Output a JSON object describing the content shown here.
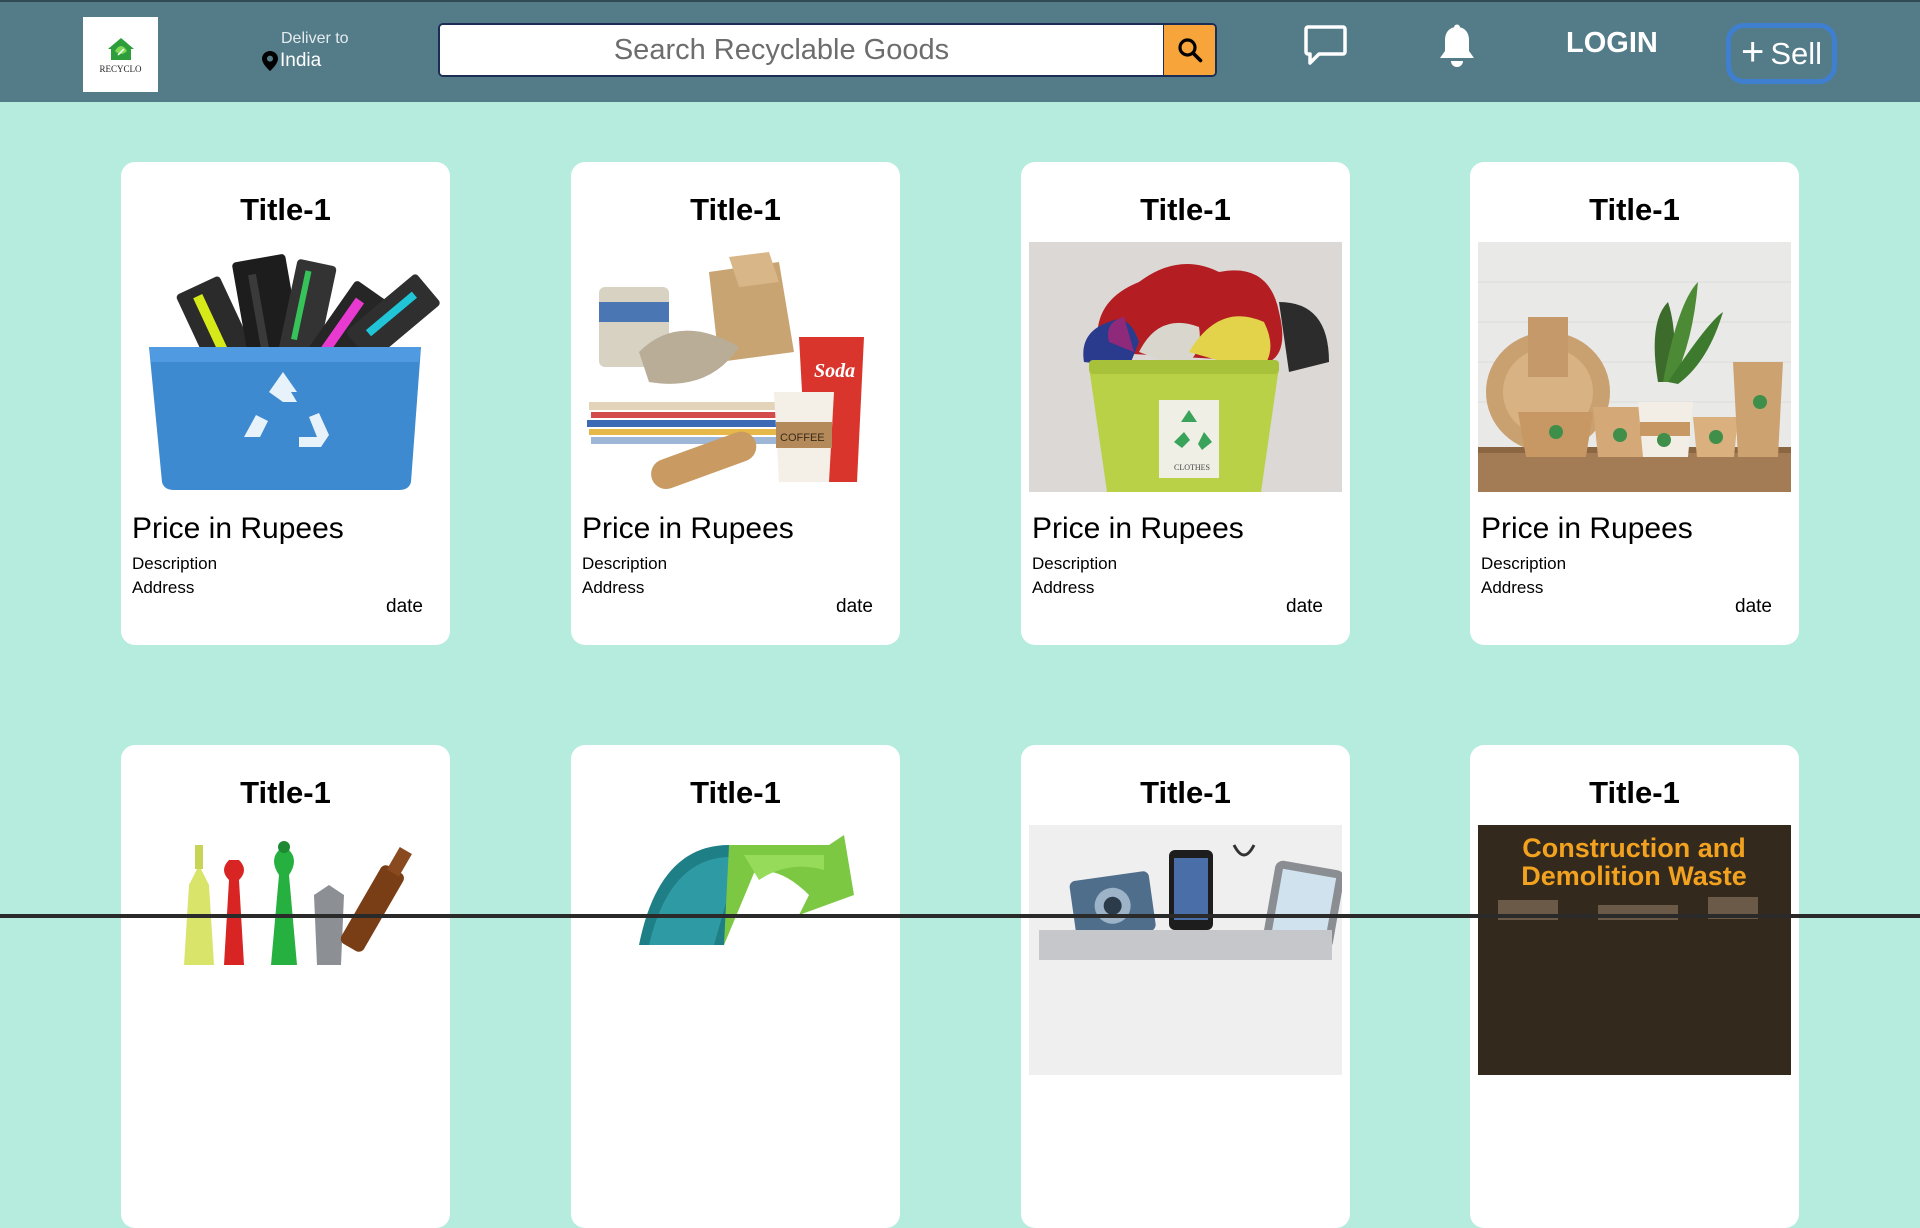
{
  "header": {
    "logo_text": "RECYCLO",
    "deliver_label": "Deliver to",
    "deliver_country": "India",
    "search_placeholder": "Search Recyclable Goods",
    "login_label": "LOGIN",
    "sell_label": "Sell",
    "colors": {
      "navbar": "#547c88",
      "search_button": "#f7a43b",
      "sell_border": "#3f7fd0",
      "page_background": "#b6ecdd"
    }
  },
  "listings": [
    {
      "title": "Title-1",
      "price": "Price in Rupees",
      "description": "Description",
      "address": "Address",
      "date": "date",
      "image": "electronic-waste-recycling-bin"
    },
    {
      "title": "Title-1",
      "price": "Price in Rupees",
      "description": "Description",
      "address": "Address",
      "date": "date",
      "image": "paper-and-cardboard-waste"
    },
    {
      "title": "Title-1",
      "price": "Price in Rupees",
      "description": "Description",
      "address": "Address",
      "date": "date",
      "image": "clothes-recycling-bin"
    },
    {
      "title": "Title-1",
      "price": "Price in Rupees",
      "description": "Description",
      "address": "Address",
      "date": "date",
      "image": "eco-paper-packaging"
    },
    {
      "title": "Title-1",
      "image": "glass-bottles"
    },
    {
      "title": "Title-1",
      "image": "recycle-arrow-symbol"
    },
    {
      "title": "Title-1",
      "image": "electronic-devices"
    },
    {
      "title": "Title-1",
      "image": "construction-waste",
      "image_text": "Construction and Demolition Waste"
    }
  ]
}
